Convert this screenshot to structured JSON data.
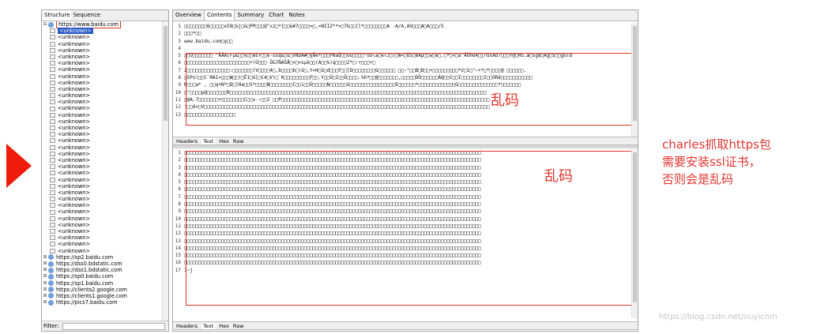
{
  "left_panel": {
    "tabs": [
      "Structure",
      "Sequence"
    ],
    "selected_host": "https://www.baidu.com",
    "tree_items": [
      "<unknown>",
      "<unknown>",
      "<unknown>",
      "<unknown>",
      "<unknown>",
      "<unknown>",
      "<unknown>",
      "<unknown>",
      "<unknown>",
      "<unknown>",
      "<unknown>",
      "<unknown>",
      "<unknown>",
      "<unknown>",
      "<unknown>",
      "<unknown>",
      "<unknown>",
      "<unknown>",
      "<unknown>",
      "<unknown>",
      "<unknown>",
      "<unknown>",
      "<unknown>",
      "<unknown>",
      "<unknown>",
      "<unknown>",
      "<unknown>",
      "<unknown>",
      "<unknown>",
      "<unknown>",
      "<unknown>",
      "<unknown>",
      "<unknown>",
      "<unknown>",
      "<unknown>"
    ],
    "hosts": [
      "https://sp2.baidu.com",
      "https://dss0.bdstatic.com",
      "https://dss1.bdstatic.com",
      "https://sp0.baidu.com",
      "https://sp1.baidu.com",
      "https://clients2.google.com",
      "https://clients1.google.com",
      "https://pics7.baidu.com"
    ],
    "filter_label": "Filter:"
  },
  "main_panel": {
    "tabs": [
      "Overview",
      "Contents",
      "Summary",
      "Chart",
      "Notes"
    ],
    "active_tab": "Contents",
    "request_lines": [
      {
        "n": "1",
        "t": "□□□□□□□□6□□□□□x59□&j□&□PP□□□@^xz□*{□□&#7□□□□=□,=NIIZ**>□7k□□[[*□□□□□□□□A ·A/A,AO□□□A□A□□□/5"
      },
      {
        "n": "2",
        "t": "□□□*□□"
      },
      {
        "n": "3",
        "t": "www.baidu.com□y□□"
      },
      {
        "n": "4",
        "t": ""
      },
      {
        "n": "5",
        "t": "□□U□□□□□□□ ^ÄÄA[Fµ&□□%□□ëÉ+□□ë·ö±q&□ü□VNDA#□§Ñé*□□□PNaÖ□□öG□□□□\"oU\\ä□eT2□)□W<□ÖS□mAp□□w□è□.□*□<□ä^ÄÖh6A□jrOxAD7□□□Y@□RG.æ□sg8□Ag□S□□gGTD"
      },
      {
        "n": "6",
        "t": "□□□□□□□□□□□□□□□□□□□□□□□+)Ú□□□ Ö&7ÑAŠÅ□<□>sµk□□(A□□%)q□□□□Z*□:+□□□+□"
      },
      {
        "n": "7",
        "t": "Z□□□□□□□□□□□□□□□:□□□□□□□(V□□□□4□,b□□□□b□)û□,Y¤H□û□d□□□F□□[D□□□□□□□□G□□□□□□ □□~\"□□B□D□□+□□□□□□□□□*V□1□\"~+*□*□□□□@ □□□□□□."
      },
      {
        "n": "8",
        "t": "□5P¢(□□C`MÀI<□□□W□□(□Ë1□G[□C4□V)□`K□□□□□□□□□F□□.Y□□Ü□I□□Ö□□□□.%h*□□@□□□□□□□,□□□□□DÖ□□□□□□Ä@□□C□□I□□□□□□□□I□□ORê□□□□□□□□□□□"
      },
      {
        "n": "9",
        "t": "N□□□a* , □□q+N*□D□]Ha□□5*□□□□N□□□□□□□□C□□i□□Ü□□□□□N□□□□□□ö□□□□□□□□□□□□□□□□E□□□□□□*□□□□□□□□□□□□□G□□□□□□□□□□□□□□*□□□□□□□"
      },
      {
        "n": "10",
        "t": "□\"□□□□p@□□□□□□□R□□□□□□□□□□□□□□□□□□□□□□□□□□□□□□□□□□□□□□□□□□□□□□□□□□□□□□□□□□□□□□□□□□□□□□□□□□□□□□□□□□□□□□□□□□"
      },
      {
        "n": "11",
        "t": "□@A.7□□□□□□□+□□□□□□□□C□□x·~□□3  □□P□□□□□□□□□□□□□□□□□□□□□□□□□□□□□□□□□□□□□□□□□□□□□□□□□□□□□□□□□□□□□□□□□□□□□□□□□"
      },
      {
        "n": "12",
        "t": "\"□□d<□V□□□□□□□□□□□□□□□□□□□□□□□□□□□□□□□□□□□□□□□□□□□□□□□□□□□□□□□□□□□□□□□□□□□□□□□□□□□□□□□□□□□□□□□□□□□□□□□□□□□□"
      },
      {
        "n": "13",
        "t": "□□□□□□□□□□□□□□□□□□"
      }
    ],
    "request_garbled_label": "乱码",
    "subtabs": [
      "Headers",
      "Text",
      "Hex",
      "Raw"
    ],
    "active_subtab_top": "Text",
    "response_lines": [
      {
        "n": "1",
        "t": "□□□□□□□□□□□□□□□□□□□□□□□□□□□□□□□□□□□□□□□□□□□□□□□□□□□□□□□□□□□□□□□□□□□□□□□□□□□□□□□□□□□□□□□□□□□□□□□□□□□□□□□□"
      },
      {
        "n": "2",
        "t": "□□□□□□□□□□□□□□□□□□□□□□□□□□□□□□□□□□□□□□□□□□□□□□□□□□□□□□□□□□□□□□□□□□□□□□□□□□□□□□□□□□□□□□□□□□□□□□□□□□□□□□□□"
      },
      {
        "n": "3",
        "t": "□□□□□□□□□□□□□□□□□□□□□□□□□□□□□□□□□□□□□□□□□□□□□□□□□□□□□□□□□□□□□□□□□□□□□□□□□□□□□□□□□□□□□□□□□□□□□□□□□□□□□□□□"
      },
      {
        "n": "4",
        "t": "□□□□□□□□□□□□□□□□□□□□□□□□□□□□□□□□□□□□□□□□□□□□□□□□□□□□□□□□□□□□□□□□□□□□□□□□□□□□□□□□□□□□□□□□□□□□□□□□□□□□□□□□"
      },
      {
        "n": "5",
        "t": "□□□□□□□□□□□□□□□□□□□□□□□□□□□□□□□□□□□□□□□□□□□□□□□□□□□□□□□□□□□□□□□□□□□□□□□□□□□□□□□□□□□□□□□□□□□□□□□□□□□□□□□□"
      },
      {
        "n": "6",
        "t": "□□□□□□□□□□□□□□□□□□□□□□□□□□□□□□□□□□□□□□□□□□□□□□□□□□□□□□□□□□□□□□□□□□□□□□□□□□□□□□□□□□□□□□□□□□□□□□□□□□□□□□□□"
      },
      {
        "n": "7",
        "t": "□□□□□□□□□□□□□□□□□□□□□□□□□□□□□□□□□□□□□□□□□□□□□□□□□□□□□□□□□□□□□□□□□□□□□□□□□□□□□□□□□□□□□□□□□□□□□□□□□□□□□□□□"
      },
      {
        "n": "8",
        "t": "□□□□□□□□□□□□□□□□□□□□□□□□□□□□□□□□□□□□□□□□□□□□□□□□□□□□□□□□□□□□□□□□□□□□□□□□□□□□□□□□□□□□□□□□□□□□□□□□□□□□□□□□"
      },
      {
        "n": "9",
        "t": "□□□□□□□□□□□□□□□□□□□□□□□□□□□□□□□□□□□□□□□□□□□□□□□□□□□□□□□□□□□□□□□□□□□□□□□□□□□□□□□□□□□□□□□□□□□□□□□□□□□□□□□□"
      },
      {
        "n": "10",
        "t": "□□□□□□□□□□□□□□□□□□□□□□□□□□□□□□□□□□□□□□□□□□□□□□□□□□□□□□□□□□□□□□□□□□□□□□□□□□□□□□□□□□□□□□□□□□□□□□□□□□□□□□□□"
      },
      {
        "n": "11",
        "t": "□□□□□□□□□□□□□□□□□□□□□□□□□□□□□□□□□□□□□□□□□□□□□□□□□□□□□□□□□□□□□□□□□□□□□□□□□□□□□□□□□□□□□□□□□□□□□□□□□□□□□□□□"
      },
      {
        "n": "12",
        "t": "□□□□□□□□□□□□□□□□□□□□□□□□□□□□□□□□□□□□□□□□□□□□□□□□□□□□□□□□□□□□□□□□□□□□□□□□□□□□□□□□□□□□□□□□□□□□□□□□□□□□□□□□"
      },
      {
        "n": "13",
        "t": "□□□□□□□□□□□□□□□□□□□□□□□□□□□□□□□□□□□□□□□□□□□□□□□□□□□□□□□□□□□□□□□□□□□□□□□□□□□□□□□□□□□□□□□□□□□□□□□□□□□□□□□□"
      },
      {
        "n": "14",
        "t": "□□□□□□□□□□□□□□□□□□□□□□□□□□□□□□□□□□□□□□□□□□□□□□□□□□□□□□□□□□□□□□□□□□□□□□□□□□□□□□□□□□□□□□□□□□□□□□□□□□□□□□□□"
      },
      {
        "n": "15",
        "t": "□□□□□□□□□□□□□□□□□□□□□□□□□□□□□□□□□□□□□□□□□□□□□□□□□□□□□□□□□□□□□□□□□□□□□□□□□□□□□□□□□□□□□□□□□□□□□□□□□□□□□□□□"
      },
      {
        "n": "16",
        "t": "□□□□□□□□□□□□□□□□□□□□□□□□□□□□□□□□□□□□□□□□□□□□□□□□□□□□□□□□□□□□□□□□□□□□□□□□□□□□□□□□□□□□□□□□□□□□□□□□□□□□□□□□"
      },
      {
        "n": "17",
        "t": "3~j"
      }
    ],
    "response_garbled_label": "乱码",
    "active_subtab_bottom": "Text"
  },
  "annotation": {
    "lines": [
      "charles抓取https包",
      "需要安装ssl证书，",
      "否则会是乱码"
    ]
  },
  "watermark": "https://blog.csdn.net/ouyicnm",
  "colors": {
    "accent_red": "#e2352e",
    "selection_blue": "#2a58c5"
  }
}
